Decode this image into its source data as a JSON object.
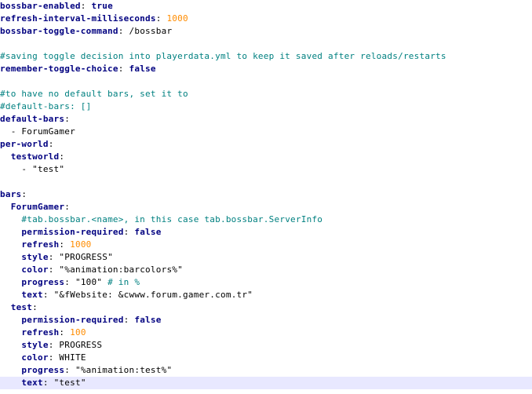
{
  "colors": {
    "key": "#000080",
    "number": "#ff8c00",
    "comment": "#008080",
    "boolean": "#000080",
    "text": "#000000",
    "current_line": "#e8e8ff",
    "background": "#ffffff"
  },
  "lines": [
    [
      {
        "t": "k",
        "v": "bossbar-enabled"
      },
      {
        "t": "p",
        "v": ": "
      },
      {
        "t": "b",
        "v": "true"
      }
    ],
    [
      {
        "t": "k",
        "v": "refresh-interval-milliseconds"
      },
      {
        "t": "p",
        "v": ": "
      },
      {
        "t": "n",
        "v": "1000"
      }
    ],
    [
      {
        "t": "k",
        "v": "bossbar-toggle-command"
      },
      {
        "t": "p",
        "v": ": "
      },
      {
        "t": "s",
        "v": "/bossbar"
      }
    ],
    [],
    [
      {
        "t": "c",
        "v": "#saving toggle decision into playerdata.yml to keep it saved after reloads/restarts"
      }
    ],
    [
      {
        "t": "k",
        "v": "remember-toggle-choice"
      },
      {
        "t": "p",
        "v": ": "
      },
      {
        "t": "b",
        "v": "false"
      }
    ],
    [],
    [
      {
        "t": "c",
        "v": "#to have no default bars, set it to"
      }
    ],
    [
      {
        "t": "c",
        "v": "#default-bars: []"
      }
    ],
    [
      {
        "t": "k",
        "v": "default-bars"
      },
      {
        "t": "p",
        "v": ":"
      }
    ],
    [
      {
        "t": "p",
        "v": "  - "
      },
      {
        "t": "s",
        "v": "ForumGamer"
      }
    ],
    [
      {
        "t": "k",
        "v": "per-world"
      },
      {
        "t": "p",
        "v": ":"
      }
    ],
    [
      {
        "t": "p",
        "v": "  "
      },
      {
        "t": "k",
        "v": "testworld"
      },
      {
        "t": "p",
        "v": ":"
      }
    ],
    [
      {
        "t": "p",
        "v": "    - "
      },
      {
        "t": "s",
        "v": "\"test\""
      }
    ],
    [],
    [
      {
        "t": "k",
        "v": "bars"
      },
      {
        "t": "p",
        "v": ":"
      }
    ],
    [
      {
        "t": "p",
        "v": "  "
      },
      {
        "t": "k",
        "v": "ForumGamer"
      },
      {
        "t": "p",
        "v": ":"
      }
    ],
    [
      {
        "t": "p",
        "v": "    "
      },
      {
        "t": "c",
        "v": "#tab.bossbar.<name>, in this case tab.bossbar.ServerInfo"
      }
    ],
    [
      {
        "t": "p",
        "v": "    "
      },
      {
        "t": "k",
        "v": "permission-required"
      },
      {
        "t": "p",
        "v": ": "
      },
      {
        "t": "b",
        "v": "false"
      }
    ],
    [
      {
        "t": "p",
        "v": "    "
      },
      {
        "t": "k",
        "v": "refresh"
      },
      {
        "t": "p",
        "v": ": "
      },
      {
        "t": "n",
        "v": "1000"
      }
    ],
    [
      {
        "t": "p",
        "v": "    "
      },
      {
        "t": "k",
        "v": "style"
      },
      {
        "t": "p",
        "v": ": "
      },
      {
        "t": "s",
        "v": "\"PROGRESS\""
      }
    ],
    [
      {
        "t": "p",
        "v": "    "
      },
      {
        "t": "k",
        "v": "color"
      },
      {
        "t": "p",
        "v": ": "
      },
      {
        "t": "s",
        "v": "\"%animation:barcolors%\""
      }
    ],
    [
      {
        "t": "p",
        "v": "    "
      },
      {
        "t": "k",
        "v": "progress"
      },
      {
        "t": "p",
        "v": ": "
      },
      {
        "t": "s",
        "v": "\"100\" "
      },
      {
        "t": "c",
        "v": "# in %"
      }
    ],
    [
      {
        "t": "p",
        "v": "    "
      },
      {
        "t": "k",
        "v": "text"
      },
      {
        "t": "p",
        "v": ": "
      },
      {
        "t": "s",
        "v": "\"&fWebsite: &cwww.forum.gamer.com.tr\""
      }
    ],
    [
      {
        "t": "p",
        "v": "  "
      },
      {
        "t": "k",
        "v": "test"
      },
      {
        "t": "p",
        "v": ":"
      }
    ],
    [
      {
        "t": "p",
        "v": "    "
      },
      {
        "t": "k",
        "v": "permission-required"
      },
      {
        "t": "p",
        "v": ": "
      },
      {
        "t": "b",
        "v": "false"
      }
    ],
    [
      {
        "t": "p",
        "v": "    "
      },
      {
        "t": "k",
        "v": "refresh"
      },
      {
        "t": "p",
        "v": ": "
      },
      {
        "t": "n",
        "v": "100"
      }
    ],
    [
      {
        "t": "p",
        "v": "    "
      },
      {
        "t": "k",
        "v": "style"
      },
      {
        "t": "p",
        "v": ": "
      },
      {
        "t": "s",
        "v": "PROGRESS"
      }
    ],
    [
      {
        "t": "p",
        "v": "    "
      },
      {
        "t": "k",
        "v": "color"
      },
      {
        "t": "p",
        "v": ": "
      },
      {
        "t": "s",
        "v": "WHITE"
      }
    ],
    [
      {
        "t": "p",
        "v": "    "
      },
      {
        "t": "k",
        "v": "progress"
      },
      {
        "t": "p",
        "v": ": "
      },
      {
        "t": "s",
        "v": "\"%animation:test%\""
      }
    ],
    [
      {
        "t": "p",
        "v": "    "
      },
      {
        "t": "k",
        "v": "text"
      },
      {
        "t": "p",
        "v": ": "
      },
      {
        "t": "s",
        "v": "\"test\""
      }
    ]
  ],
  "current_line": 30
}
